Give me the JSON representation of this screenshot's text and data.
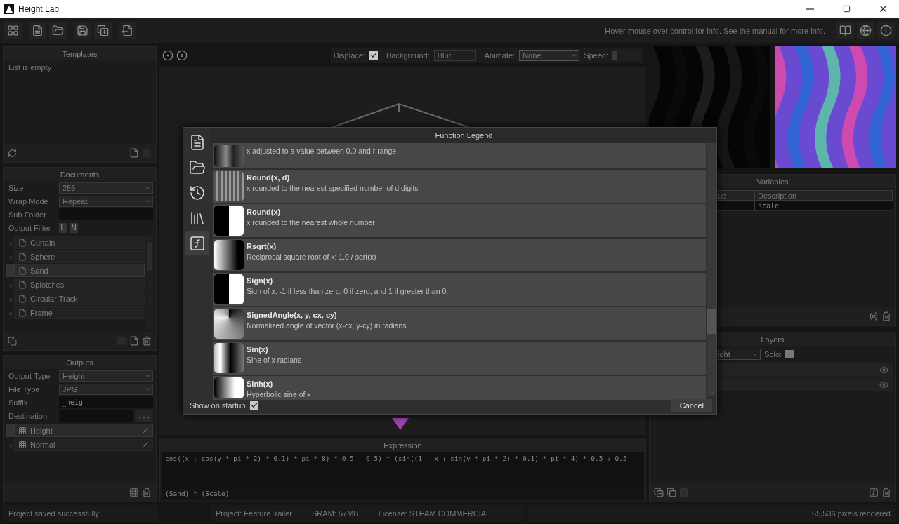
{
  "window": {
    "title": "Height Lab"
  },
  "toolbar": {
    "hint": "Hover mouse over control for info. See the manual for more info."
  },
  "templates": {
    "title": "Templates",
    "empty_text": "List is empty"
  },
  "documents": {
    "title": "Documents",
    "fields": [
      {
        "kind": "select",
        "label": "Size",
        "value": "256"
      },
      {
        "kind": "select",
        "label": "Wrap Mode",
        "value": "Repeat"
      },
      {
        "kind": "text",
        "label": "Sub Folder"
      }
    ],
    "output_filter": {
      "label": "Output Filter",
      "toggles": [
        "H",
        "N"
      ]
    },
    "items": [
      {
        "name": "Curtain",
        "selected": false
      },
      {
        "name": "Sphere",
        "selected": false
      },
      {
        "name": "Sand",
        "selected": true
      },
      {
        "name": "Splotches",
        "selected": false
      },
      {
        "name": "Circular Track",
        "selected": false
      },
      {
        "name": "Frame",
        "selected": false
      }
    ]
  },
  "outputs": {
    "title": "Outputs",
    "fields": [
      {
        "kind": "select",
        "label": "Output Type",
        "value": "Height"
      },
      {
        "kind": "select",
        "label": "File Type",
        "value": "JPG"
      },
      {
        "kind": "text",
        "label": "Suffix",
        "value": "_heig"
      },
      {
        "kind": "browse",
        "label": "Destination",
        "button": "..."
      }
    ],
    "items": [
      {
        "name": "Height",
        "selected": true,
        "checked": true
      },
      {
        "name": "Normal",
        "selected": false,
        "checked": true
      }
    ]
  },
  "viewport": {
    "displace": {
      "label": "Displace:",
      "checked": true
    },
    "background": {
      "label": "Background:",
      "value": "Blur"
    },
    "animate": {
      "label": "Animate:",
      "value": "None"
    },
    "speed": {
      "label": "Speed:",
      "level": 0
    }
  },
  "expression": {
    "title": "Expression",
    "code": "cos((x + cos(y * pi * 2) * 0.1) * pi * 8) * 0.5 + 0.5) * (sin((1 - x + sin(y * pi * 2) * 0.1) * pi * 4) * 0.5 + 0.5",
    "summary": "(Sand) * (Scale)"
  },
  "variables": {
    "title": "Variables",
    "columns": [
      "ue",
      "Description"
    ],
    "rows": [
      {
        "description": "scale"
      }
    ]
  },
  "layers": {
    "title": "Layers",
    "blend": "ight",
    "solo": {
      "label": "Solo:",
      "checked": false
    },
    "rows": [
      {
        "visible": true
      },
      {
        "visible": true
      }
    ]
  },
  "dialog": {
    "title": "Function Legend",
    "tabs": [
      {
        "kind": "document",
        "selected": false
      },
      {
        "kind": "folder",
        "selected": false
      },
      {
        "kind": "history",
        "selected": false
      },
      {
        "kind": "library",
        "selected": false
      },
      {
        "kind": "function",
        "selected": true
      }
    ],
    "functions": [
      {
        "description": "x adjusted to a value between 0.0 and r range",
        "kind": "pulse"
      },
      {
        "name": "Round(x, d)",
        "description": "x rounded to the nearest specified number of d digits",
        "kind": "steps"
      },
      {
        "name": "Round(x)",
        "description": "x rounded to the nearest whole number",
        "kind": "split"
      },
      {
        "name": "Rsqrt(x)",
        "description": "Reciprocal square root of x: 1.0 / sqrt(x)",
        "kind": "falloff"
      },
      {
        "name": "Sign(x)",
        "description": "Sign of x. -1 if less than zero, 0 if zero, and 1 if greater than 0.",
        "kind": "split"
      },
      {
        "name": "SignedAngle(x, y, cx, cy)",
        "description": "Normalized angle of vector (x-cx, y-cy) in radians",
        "kind": "angle"
      },
      {
        "name": "Sin(x)",
        "description": "Sine of x radians",
        "kind": "sine"
      },
      {
        "name": "Sinh(x)",
        "description": "Hyperbolic sine of x",
        "kind": "sinh"
      }
    ],
    "show_on_startup": {
      "label": "Show on startup",
      "checked": true
    },
    "cancel": "Cancel"
  },
  "status_bar": {
    "message": "Project saved successfully",
    "project": "Project: FeatureTrailer",
    "sram": "SRAM: 57MB",
    "license": "License: STEAM COMMERCIAL",
    "pixels": "65,536 pixels rendered"
  }
}
